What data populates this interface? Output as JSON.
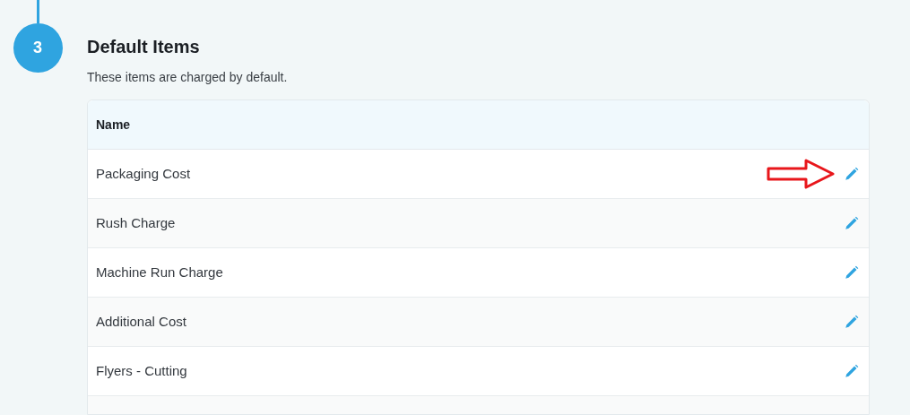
{
  "step": {
    "number": "3",
    "title": "Default Items",
    "description": "These items are charged by default."
  },
  "table": {
    "columns": [
      "Name"
    ],
    "rows": [
      {
        "name": "Packaging Cost",
        "highlighted": true
      },
      {
        "name": "Rush Charge",
        "highlighted": false
      },
      {
        "name": "Machine Run Charge",
        "highlighted": false
      },
      {
        "name": "Additional Cost",
        "highlighted": false
      },
      {
        "name": "Flyers - Cutting",
        "highlighted": false
      }
    ]
  }
}
